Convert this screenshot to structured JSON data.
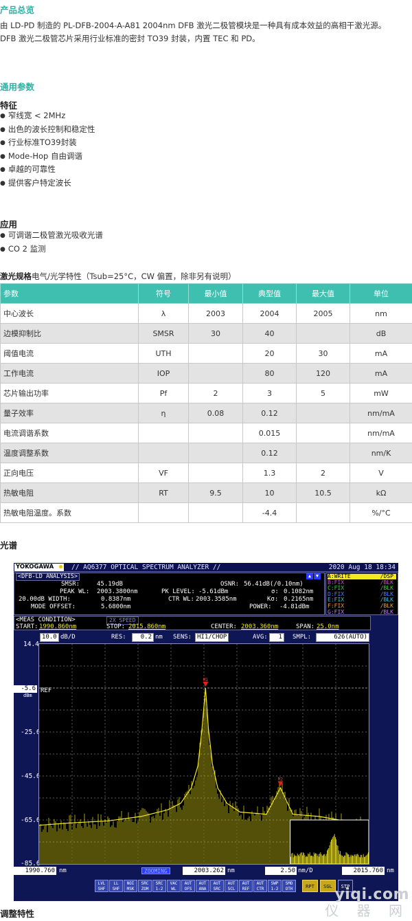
{
  "overview": {
    "title": "产品总览",
    "line1": "由 LD-PD 制造的 PL-DFB-2004-A-A81 2004nm DFB 激光二极管模块是一种具有成本效益的高相干激光源。",
    "line2": "DFB 激光二极管芯片采用行业标准的密封 TO39 封装，内置 TEC 和 PD。"
  },
  "general": {
    "title": "通用参数"
  },
  "features": {
    "title": "特征",
    "items": [
      "窄线宽 < 2MHz",
      "出色的波长控制和稳定性",
      "行业标准TO39封装",
      "Mode-Hop 自由调谐",
      "卓越的可靠性",
      "提供客户特定波长"
    ]
  },
  "applications": {
    "title": "应用",
    "items": [
      "可调谐二极管激光吸收光谱",
      "CO 2 监测"
    ]
  },
  "spec": {
    "heading_bold": "激光规格",
    "heading_rest": "电气/光学特性（Tsub=25°C，CW 偏置，除非另有说明）",
    "headers": [
      "参数",
      "符号",
      "最小值",
      "典型值",
      "最大值",
      "单位"
    ],
    "rows": [
      [
        "中心波长",
        "λ",
        "2003",
        "2004",
        "2005",
        "nm"
      ],
      [
        "边模抑制比",
        "SMSR",
        "30",
        "40",
        "",
        "dB"
      ],
      [
        "阈值电流",
        "UTH",
        "",
        "20",
        "30",
        "mA"
      ],
      [
        "工作电流",
        "IOP",
        "",
        "80",
        "120",
        "mA"
      ],
      [
        "芯片输出功率",
        "Pf",
        "2",
        "3",
        "5",
        "mW"
      ],
      [
        "量子效率",
        "η",
        "0.08",
        "0.12",
        "",
        "nm/mA"
      ],
      [
        "电流调谐系数",
        "",
        "",
        "0.015",
        "",
        "nm/mA"
      ],
      [
        "温度调整系数",
        "",
        "",
        "0.12",
        "",
        "nm/K"
      ],
      [
        "正向电压",
        "VF",
        "",
        "1.3",
        "2",
        "V"
      ],
      [
        "热敏电阻",
        "RT",
        "9.5",
        "10",
        "10.5",
        "kΩ"
      ],
      [
        "热敏电阻温度。系数",
        "",
        "",
        "-4.4",
        "",
        "%/°C"
      ]
    ]
  },
  "spectrum": {
    "title": "光谱",
    "brand": "YOKOGAWA",
    "instrument": "// AQ6377 OPTICAL SPECTRUM ANALYZER //",
    "datetime": "2020 Aug 18 18:34",
    "panel_label": "<DFB-LD ANALYSIS>",
    "results": {
      "smsr_label": "SMSR:",
      "smsr": "45.19dB",
      "peakwl_label": "PEAK WL:",
      "peakwl": "2003.3800nm",
      "width_label": "20.00dB WIDTH:",
      "width": "0.8387nm",
      "offset_label": "MODE OFFSET:",
      "offset": "5.6800nm",
      "osnr_label": "OSNR:",
      "osnr": "56.41dB(/0.10nm)",
      "pklevel_label": "PK LEVEL:",
      "pklevel": "-5.61dBm",
      "sigma_label": "σ:",
      "sigma": "0.1082nm",
      "ctrwl_label": "CTR WL:",
      "ctrwl": "2003.3585nm",
      "ksigma_label": "Kσ:",
      "ksigma": "0.2165nm",
      "power_label": "POWER:",
      "power": "-4.81dBm"
    },
    "traces": [
      {
        "label": "A:WRITE",
        "mode": "/DSP",
        "color": "#f5ea20"
      },
      {
        "label": "B:FIX",
        "mode": "/BLK",
        "color": "#d050d0"
      },
      {
        "label": "C:FIX",
        "mode": "/BLK",
        "color": "#40d040"
      },
      {
        "label": "D:FIX",
        "mode": "/BLK",
        "color": "#5080ff"
      },
      {
        "label": "E:FIX",
        "mode": "/BLK",
        "color": "#40c0e0"
      },
      {
        "label": "F:FIX",
        "mode": "/BLK",
        "color": "#f0a040"
      },
      {
        "label": "G:FIX",
        "mode": "/BLK",
        "color": "#c080ff"
      }
    ],
    "meas": {
      "label": "<MEAS CONDITION>",
      "speed": "2X SPEED",
      "start_label": "START:",
      "start": "1990.860nm",
      "stop_label": "STOP:",
      "stop": "2015.860nm",
      "center_label": "CENTER:",
      "center": "2003.360nm",
      "span_label": "SPAN:",
      "span": "25.0nm"
    },
    "settings": {
      "scale": "10.0",
      "scale_unit": "dB/D",
      "res_label": "RES:",
      "res": "0.2",
      "res_unit": "nm",
      "sens_label": "SENS:",
      "sens": "HI1/CHOP",
      "avg_label": "AVG:",
      "avg": "1",
      "smpl_label": "SMPL:",
      "smpl": "626(AUTO)"
    },
    "ref_label": "REF",
    "ref_unit": "dBm",
    "x_bottom": {
      "left": "1990.760",
      "left_unit": "nm",
      "zooming": "ZOOMING",
      "center": "2003.262",
      "center_unit": "nm",
      "div": "2.50",
      "div_unit": "nm/D",
      "right": "2015.760",
      "right_unit": "nm"
    },
    "softkeys": [
      {
        "l1": "LVL",
        "l2": "SHF",
        "style": "blue"
      },
      {
        "l1": "LL",
        "l2": "SHF",
        "style": "blue"
      },
      {
        "l1": "NOI",
        "l2": "MSK",
        "style": "blue"
      },
      {
        "l1": "SRC",
        "l2": "ZOM",
        "style": "blue"
      },
      {
        "l1": "SRC",
        "l2": "1-2",
        "style": "blue"
      },
      {
        "l1": "VAC",
        "l2": "WL",
        "style": "blue"
      },
      {
        "l1": "AUT",
        "l2": "OFS",
        "style": "blue"
      },
      {
        "l1": "AUT",
        "l2": "ANA",
        "style": "blue"
      },
      {
        "l1": "AUT",
        "l2": "SRC",
        "style": "blue"
      },
      {
        "l1": "AUT",
        "l2": "SCL",
        "style": "blue"
      },
      {
        "l1": "AUT",
        "l2": "REF",
        "style": "blue"
      },
      {
        "l1": "AUT",
        "l2": "CTR",
        "style": "blue"
      },
      {
        "l1": "SWP",
        "l2": "1-2",
        "style": "blue"
      },
      {
        "l1": "SMO",
        "l2": "OTH",
        "style": "blue"
      },
      {
        "l1": "RPT",
        "l2": "",
        "style": "yellow"
      },
      {
        "l1": "SGL",
        "l2": "",
        "style": "yellow"
      },
      {
        "l1": "STP",
        "l2": "",
        "style": "dark"
      }
    ]
  },
  "chart_data": {
    "type": "line",
    "title": "",
    "xlabel": "",
    "ylabel": "",
    "x_unit": "nm",
    "y_unit": "dBm",
    "xlim": [
      1990.76,
      2015.76
    ],
    "ylim": [
      -85.6,
      14.4
    ],
    "ytick_labels": [
      "14.4",
      "-5.6",
      "-25.6",
      "-45.6",
      "-65.6",
      "-85.6"
    ],
    "yticks": [
      14.4,
      -5.6,
      -25.6,
      -45.6,
      -65.6,
      -85.6
    ],
    "reference_level": -5.6,
    "grid": true,
    "series": [
      {
        "color": "#f5ea20",
        "x": [
          1990.76,
          1993.0,
          1996.0,
          1998.5,
          2000.5,
          2001.5,
          2002.3,
          2002.8,
          2003.1,
          2003.38,
          2003.6,
          2003.9,
          2004.3,
          2005.0,
          2006.0,
          2008.0,
          2009.06,
          2010.0,
          2012.0,
          2015.76
        ],
        "y": [
          -68.0,
          -67.0,
          -66.0,
          -64.0,
          -61.0,
          -58.0,
          -51.0,
          -41.0,
          -25.0,
          -5.61,
          -24.0,
          -40.0,
          -51.0,
          -58.0,
          -62.0,
          -63.0,
          -51.0,
          -63.0,
          -64.0,
          -68.0
        ]
      }
    ],
    "markers": [
      {
        "x": 2003.38,
        "y": -5.61,
        "label": "M1"
      },
      {
        "x": 2009.06,
        "y": -50.8,
        "label": "M2"
      }
    ],
    "inset": {
      "x_range": [
        2009.8,
        2015.76
      ],
      "y_range": [
        -85.6,
        -65.6
      ],
      "peak_x": 2012.8,
      "peak_y": -74.0
    }
  },
  "tuning": {
    "title": "调整特性"
  },
  "watermark": {
    "line1": "yiqi.com",
    "line2": "仪 器 网"
  }
}
